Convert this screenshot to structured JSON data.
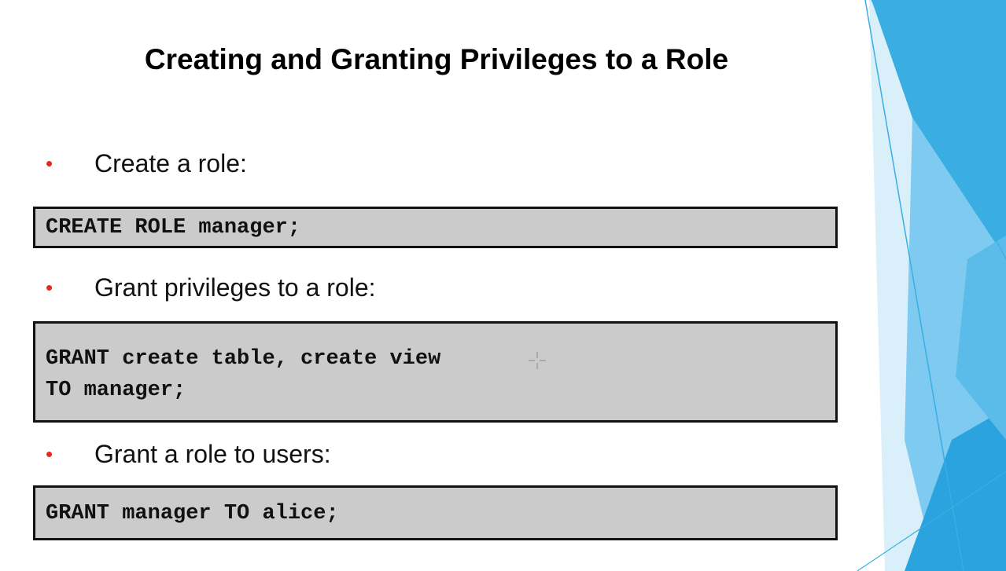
{
  "slide": {
    "title": "Creating and Granting Privileges to a Role",
    "bullet_glyph": "•",
    "sections": [
      {
        "bullet": "Create a role:",
        "code": [
          "CREATE ROLE manager;"
        ]
      },
      {
        "bullet": "Grant privileges to a role:",
        "code": [
          "GRANT create table, create view",
          "TO manager;"
        ]
      },
      {
        "bullet": "Grant a role to users:",
        "code": [
          "GRANT manager TO alice;"
        ]
      }
    ]
  },
  "colors": {
    "bullet": "#e8281c",
    "code_background": "#cbcbcb",
    "accent_blue": "#2aa8e0"
  },
  "icons": {
    "decor": "blue-triangle-shapes",
    "cursor": "crosshair-cursor-icon"
  }
}
